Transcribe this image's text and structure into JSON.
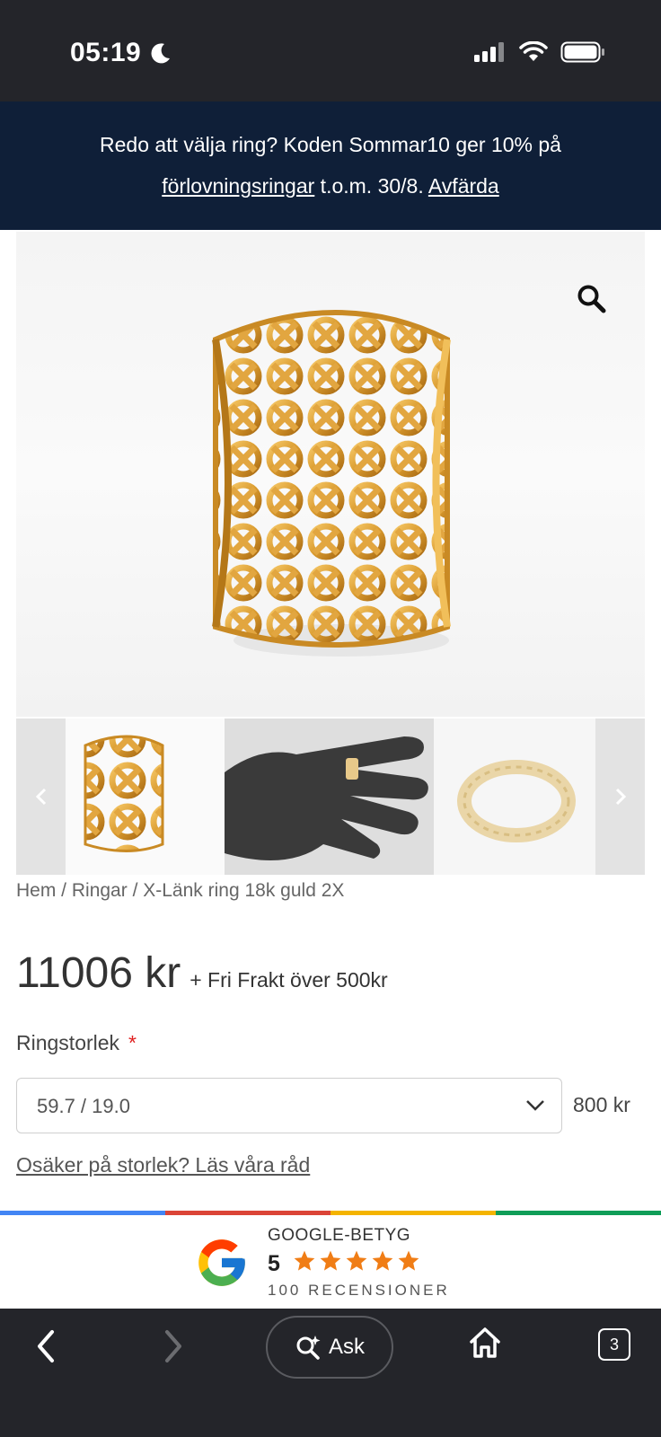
{
  "status_bar": {
    "time": "05:19",
    "icons": [
      "moon-icon",
      "cellular-signal-icon",
      "wifi-icon",
      "battery-icon"
    ]
  },
  "promo": {
    "text_before": "Redo att välja ring? Koden Sommar10 ger 10% på",
    "link_label": "förlovningsringar",
    "text_after": " t.o.m. 30/8. ",
    "dismiss_label": "Avfärda"
  },
  "gallery": {
    "zoom_icon": "magnifier-icon",
    "prev_icon": "chevron-left-icon",
    "next_icon": "chevron-right-icon"
  },
  "breadcrumb": {
    "items": [
      "Hem",
      "Ringar",
      "X-Länk ring 18k guld 2X"
    ],
    "separator": " / "
  },
  "product": {
    "price": "11006 kr",
    "shipping_note": "+ Fri Frakt över 500kr",
    "size_label": "Ringstorlek",
    "required_mark": "*",
    "size_value": "59.7 / 19.0",
    "size_price": "800 kr",
    "size_help_link": "Osäker på storlek? Läs våra råd"
  },
  "google_badge": {
    "title": "GOOGLE-BETYG",
    "score": "5",
    "stars": 5,
    "reviews": "100 RECENSIONER",
    "bar_colors": [
      "#4285f4",
      "#db4437",
      "#f4b400",
      "#0f9d58"
    ],
    "star_color": "#f07d15"
  },
  "toolbar": {
    "ask_label": "Ask",
    "tab_count": "3"
  }
}
